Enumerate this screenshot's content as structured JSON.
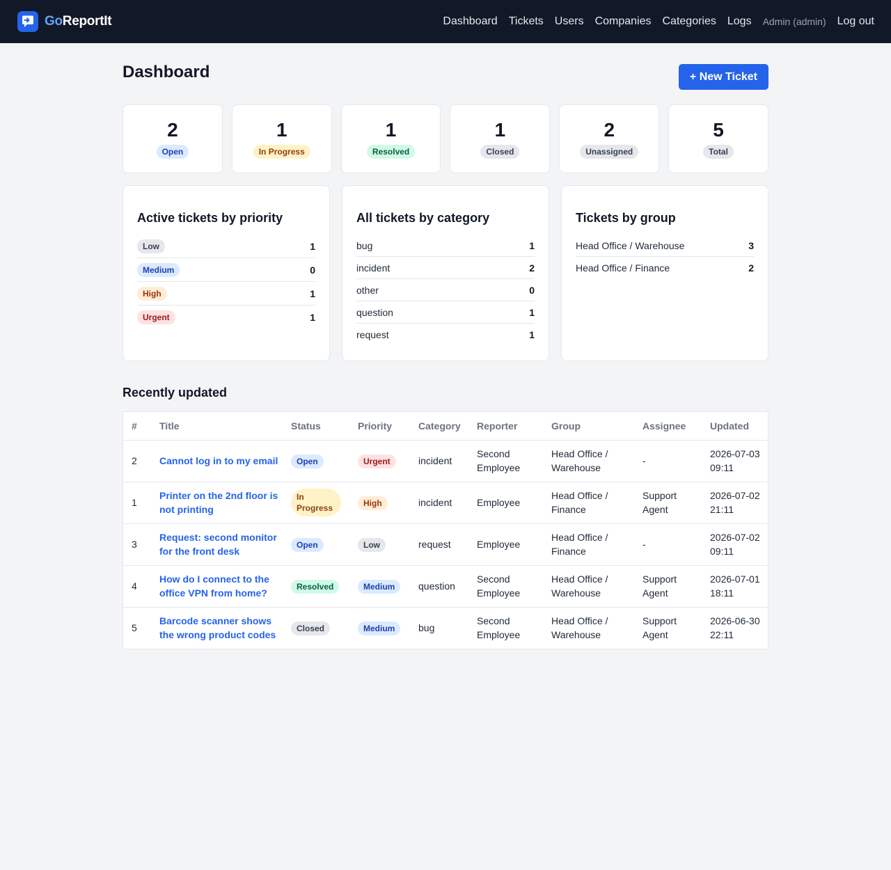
{
  "brand": {
    "go": "Go",
    "rest": "ReportIt"
  },
  "nav": {
    "links": [
      "Dashboard",
      "Tickets",
      "Users",
      "Companies",
      "Categories",
      "Logs"
    ],
    "user": "Admin (admin)",
    "logout": "Log out"
  },
  "page": {
    "title": "Dashboard",
    "new_ticket": "+ New Ticket"
  },
  "stats": [
    {
      "value": "2",
      "label": "Open"
    },
    {
      "value": "1",
      "label": "In Progress"
    },
    {
      "value": "1",
      "label": "Resolved"
    },
    {
      "value": "1",
      "label": "Closed"
    },
    {
      "value": "2",
      "label": "Unassigned"
    },
    {
      "value": "5",
      "label": "Total"
    }
  ],
  "priority_panel": {
    "title": "Active tickets by priority",
    "rows": [
      {
        "label": "Low",
        "value": "1"
      },
      {
        "label": "Medium",
        "value": "0"
      },
      {
        "label": "High",
        "value": "1"
      },
      {
        "label": "Urgent",
        "value": "1"
      }
    ]
  },
  "category_panel": {
    "title": "All tickets by category",
    "rows": [
      {
        "label": "bug",
        "value": "1"
      },
      {
        "label": "incident",
        "value": "2"
      },
      {
        "label": "other",
        "value": "0"
      },
      {
        "label": "question",
        "value": "1"
      },
      {
        "label": "request",
        "value": "1"
      }
    ]
  },
  "group_panel": {
    "title": "Tickets by group",
    "rows": [
      {
        "label": "Head Office / Warehouse",
        "value": "3"
      },
      {
        "label": "Head Office / Finance",
        "value": "2"
      }
    ]
  },
  "recent": {
    "title": "Recently updated",
    "headers": [
      "#",
      "Title",
      "Status",
      "Priority",
      "Category",
      "Reporter",
      "Group",
      "Assignee",
      "Updated"
    ],
    "rows": [
      {
        "id": "2",
        "title": "Cannot log in to my email",
        "status": "Open",
        "priority": "Urgent",
        "category": "incident",
        "reporter": "Second Employee",
        "group": "Head Office / Warehouse",
        "assignee": "-",
        "updated": "2026-07-03 09:11"
      },
      {
        "id": "1",
        "title": "Printer on the 2nd floor is not printing",
        "status": "In Progress",
        "priority": "High",
        "category": "incident",
        "reporter": "Employee",
        "group": "Head Office / Finance",
        "assignee": "Support Agent",
        "updated": "2026-07-02 21:11"
      },
      {
        "id": "3",
        "title": "Request: second monitor for the front desk",
        "status": "Open",
        "priority": "Low",
        "category": "request",
        "reporter": "Employee",
        "group": "Head Office / Finance",
        "assignee": "-",
        "updated": "2026-07-02 09:11"
      },
      {
        "id": "4",
        "title": "How do I connect to the office VPN from home?",
        "status": "Resolved",
        "priority": "Medium",
        "category": "question",
        "reporter": "Second Employee",
        "group": "Head Office / Warehouse",
        "assignee": "Support Agent",
        "updated": "2026-07-01 18:11"
      },
      {
        "id": "5",
        "title": "Barcode scanner shows the wrong product codes",
        "status": "Closed",
        "priority": "Medium",
        "category": "bug",
        "reporter": "Second Employee",
        "group": "Head Office / Warehouse",
        "assignee": "Support Agent",
        "updated": "2026-06-30 22:11"
      }
    ]
  },
  "colors": {
    "navbar": "#111827",
    "accent": "#2563eb",
    "background": "#f3f4f6"
  },
  "icons": {
    "logo": "chat-bubble-arrow-icon"
  }
}
